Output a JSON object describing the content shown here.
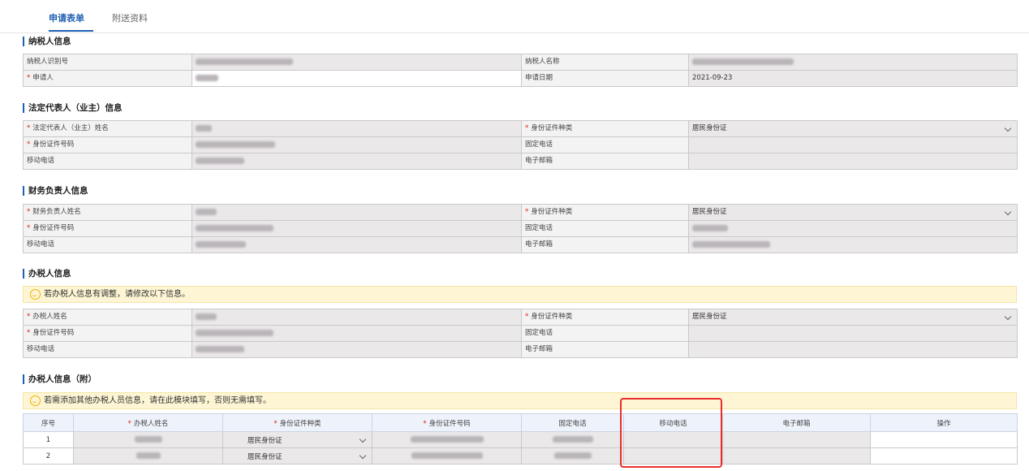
{
  "tabs": [
    "申请表单",
    "附送资料"
  ],
  "sections": {
    "taxpayer": {
      "title": "纳税人信息",
      "id_label": "纳税人识别号",
      "name_label": "纳税人名称",
      "applicant_label": "申请人",
      "date_label": "申请日期",
      "date_value": "2021-09-23"
    },
    "legal_rep": {
      "title": "法定代表人（业主）信息",
      "name_label": "法定代表人（业主）姓名",
      "id_type_label": "身份证件种类",
      "id_type_value": "居民身份证",
      "id_no_label": "身份证件号码",
      "tel_label": "固定电话",
      "mobile_label": "移动电话",
      "email_label": "电子邮箱"
    },
    "finance": {
      "title": "财务负责人信息",
      "name_label": "财务负责人姓名",
      "id_type_label": "身份证件种类",
      "id_type_value": "居民身份证",
      "id_no_label": "身份证件号码",
      "tel_label": "固定电话",
      "mobile_label": "移动电话",
      "email_label": "电子邮箱"
    },
    "agent": {
      "title": "办税人信息",
      "notice": "若办税人信息有调整，请修改以下信息。",
      "name_label": "办税人姓名",
      "id_type_label": "身份证件种类",
      "id_type_value": "居民身份证",
      "id_no_label": "身份证件号码",
      "tel_label": "固定电话",
      "mobile_label": "移动电话",
      "email_label": "电子邮箱"
    },
    "agent_extra": {
      "title": "办税人信息（附）",
      "notice": "若需添加其他办税人员信息，请在此模块填写，否则无需填写。",
      "columns": [
        "序号",
        "办税人姓名",
        "身份证件种类",
        "身份证件号码",
        "固定电话",
        "移动电话",
        "电子邮箱",
        "操作"
      ],
      "rows": [
        {
          "no": "1",
          "id_type": "居民身份证"
        },
        {
          "no": "2",
          "id_type": "居民身份证"
        }
      ]
    }
  },
  "colors": {
    "accent": "#1f5fb4",
    "required": "#e02020",
    "notice_bg": "#fdf5d4",
    "highlight": "#e8302b"
  },
  "icons": [
    "smile-icon",
    "chevron-down-icon"
  ]
}
